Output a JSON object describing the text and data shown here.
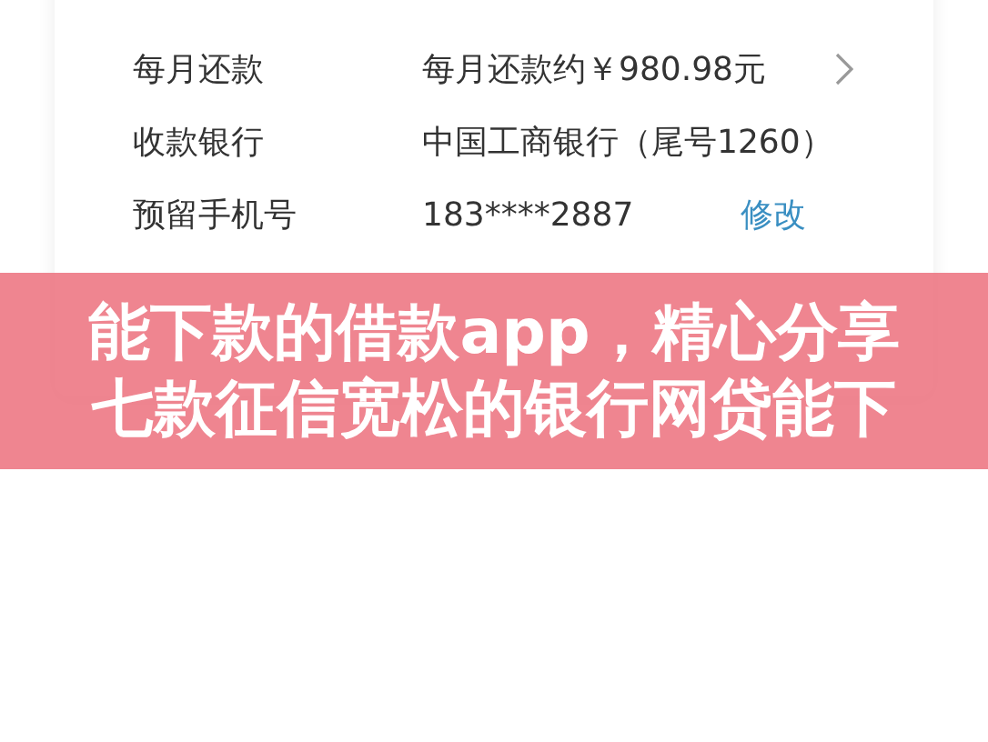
{
  "rows": [
    {
      "label": "每月还款",
      "value": "每月还款约￥980.98元",
      "chevron": true
    },
    {
      "label": "收款银行",
      "value": "中国工商银行（尾号1260）",
      "chevron": false
    },
    {
      "label": "预留手机号",
      "value": "183****2887",
      "action": "修改",
      "chevron": false
    }
  ],
  "banner": {
    "lines": [
      "能下款的借款app，精心分享",
      "七款征信宽松的银行网贷能下"
    ]
  }
}
